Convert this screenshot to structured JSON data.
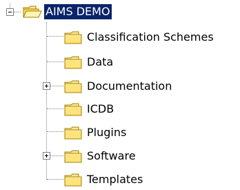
{
  "tree": {
    "root": {
      "label": "AIMS DEMO",
      "expanded": true,
      "selected": true,
      "icon": "open-folder-icon"
    },
    "children": [
      {
        "label": "Classification Schemes",
        "has_children": false,
        "icon": "folder-icon"
      },
      {
        "label": "Data",
        "has_children": false,
        "icon": "folder-icon"
      },
      {
        "label": "Documentation",
        "has_children": true,
        "expanded": false,
        "icon": "folder-icon"
      },
      {
        "label": "ICDB",
        "has_children": false,
        "icon": "folder-icon"
      },
      {
        "label": "Plugins",
        "has_children": false,
        "icon": "folder-icon"
      },
      {
        "label": "Software",
        "has_children": true,
        "expanded": false,
        "icon": "folder-icon"
      },
      {
        "label": "Templates",
        "has_children": false,
        "icon": "folder-icon"
      }
    ]
  },
  "colors": {
    "selection_background": "#0a246a",
    "selection_text": "#ffffff",
    "folder_fill": "#ffe88c",
    "folder_stroke": "#a08000",
    "tree_lines": "#808080"
  }
}
